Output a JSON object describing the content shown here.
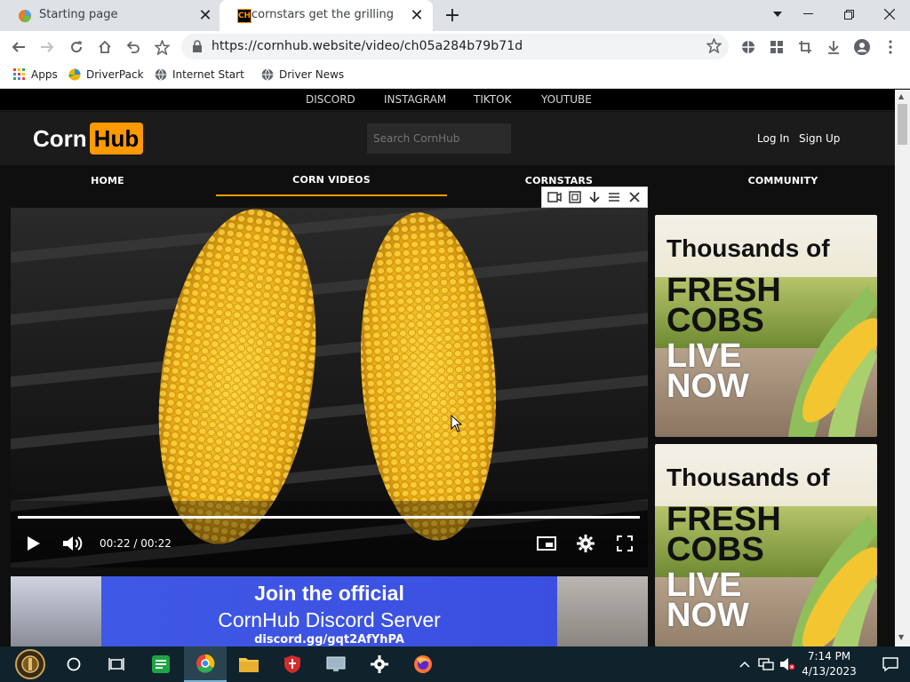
{
  "browser": {
    "tabs": [
      {
        "title": "Starting page",
        "favicon": "browser-icon",
        "active": false
      },
      {
        "title": "cornstars get the grilling of a lifetime",
        "favicon": "cornhub-icon",
        "favicon_text": "CH",
        "active": true
      }
    ],
    "url": "https://cornhub.website/video/ch05a284b79b71d",
    "bookmarks": [
      {
        "label": "Apps",
        "icon": "apps-grid-icon"
      },
      {
        "label": "DriverPack",
        "icon": "driverpack-icon"
      },
      {
        "label": "Internet Start",
        "icon": "globe-icon"
      },
      {
        "label": "Driver News",
        "icon": "globe-icon"
      }
    ]
  },
  "site": {
    "social_links": [
      "DISCORD",
      "INSTAGRAM",
      "TIKTOK",
      "YOUTUBE"
    ],
    "logo": {
      "part1": "Corn",
      "part2": "Hub"
    },
    "search_placeholder": "Search CornHub",
    "auth": {
      "login": "Log In",
      "signup": "Sign Up"
    },
    "nav": [
      {
        "label": "HOME",
        "active": false
      },
      {
        "label": "CORN VIDEOS",
        "active": true
      },
      {
        "label": "CORNSTARS",
        "active": false
      },
      {
        "label": "COMMUNITY",
        "active": false
      }
    ],
    "accent_color": "#ff9900"
  },
  "video": {
    "time": "00:22 / 00:22",
    "progress": 1.0,
    "controls": [
      "play-icon",
      "volume-icon",
      "miniplayer-icon",
      "settings-icon",
      "fullscreen-icon"
    ]
  },
  "banner": {
    "line1": "Join the official",
    "line2": "CornHub Discord Server",
    "line3": "discord.gg/gqt2AfYhPA"
  },
  "ads": [
    {
      "line1": "Thousands of",
      "line2a": "FRESH",
      "line2b": "COBS",
      "line3a": "LIVE",
      "line3b": "NOW"
    },
    {
      "line1": "Thousands of",
      "line2a": "FRESH",
      "line2b": "COBS",
      "line3a": "LIVE",
      "line3b": "NOW"
    }
  ],
  "taskbar": {
    "time": "7:14 PM",
    "date": "4/13/2023"
  }
}
